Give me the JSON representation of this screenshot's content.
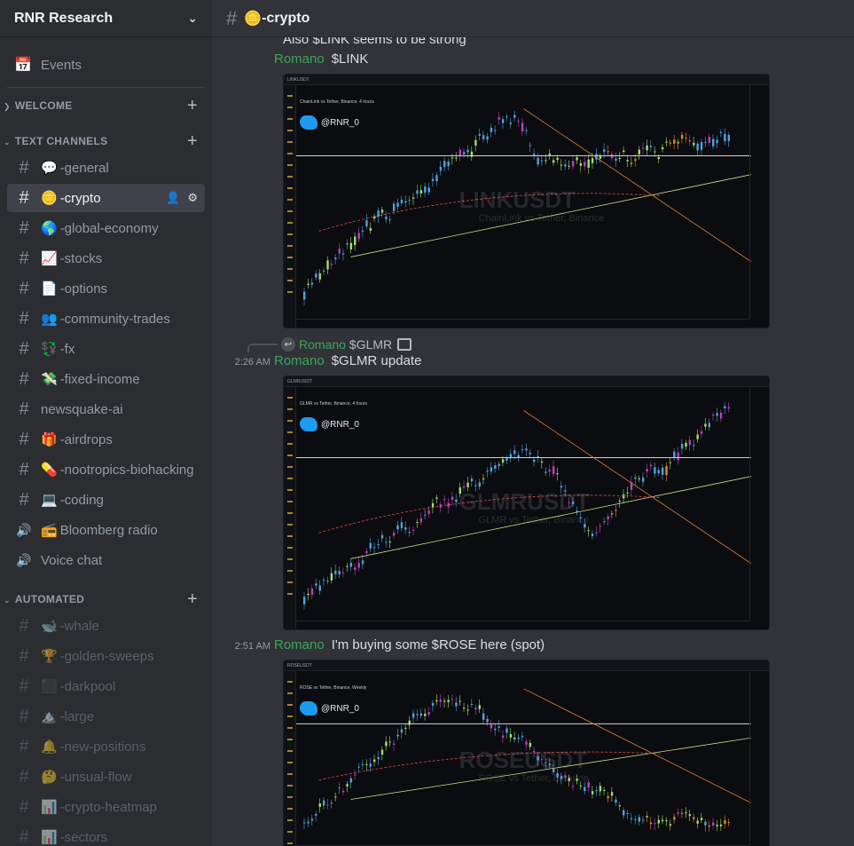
{
  "server": {
    "name": "RNR Research"
  },
  "sidebar": {
    "events_label": "Events",
    "categories": {
      "welcome": "WELCOME",
      "text_channels": "TEXT CHANNELS",
      "automated": "AUTOMATED"
    },
    "channels": [
      {
        "emoji": "💬",
        "name": "-general"
      },
      {
        "emoji": "🪙",
        "name": "-crypto"
      },
      {
        "emoji": "🌎",
        "name": "-global-economy"
      },
      {
        "emoji": "📈",
        "name": "-stocks"
      },
      {
        "emoji": "📄",
        "name": "-options"
      },
      {
        "emoji": "👥",
        "name": "-community-trades"
      },
      {
        "emoji": "💱",
        "name": "-fx"
      },
      {
        "emoji": "💸",
        "name": "-fixed-income"
      },
      {
        "emoji": "",
        "name": "newsquake-ai"
      },
      {
        "emoji": "🎁",
        "name": "-airdrops"
      },
      {
        "emoji": "💊",
        "name": "-nootropics-biohacking"
      },
      {
        "emoji": "💻",
        "name": "-coding"
      },
      {
        "emoji": "📻",
        "name": " Bloomberg radio"
      },
      {
        "emoji": "",
        "name": "Voice chat"
      }
    ],
    "automated": [
      {
        "emoji": "🐋",
        "name": "-whale"
      },
      {
        "emoji": "🏆",
        "name": "-golden-sweeps"
      },
      {
        "emoji": "⬛",
        "name": "-darkpool"
      },
      {
        "emoji": "🏔️",
        "name": "-large"
      },
      {
        "emoji": "🔔",
        "name": "-new-positions"
      },
      {
        "emoji": "🤔",
        "name": "-unsual-flow"
      },
      {
        "emoji": "📊",
        "name": "-crypto-heatmap"
      },
      {
        "emoji": "📊",
        "name": "-sectors"
      }
    ]
  },
  "header": {
    "channel": "-crypto",
    "emoji": "🪙"
  },
  "messages": {
    "cut_text": "Also $LINK seems to be strong",
    "m1": {
      "author": "Romano",
      "text": "$LINK"
    },
    "m2": {
      "reply_author": "Romano",
      "reply_text": "$GLMR",
      "time": "2:26 AM",
      "author": "Romano",
      "text": "$GLMR update"
    },
    "m3": {
      "time": "2:51 AM",
      "author": "Romano",
      "text": "I'm buying some $ROSE here (spot)"
    }
  },
  "charts": {
    "handle": "@RNR_0",
    "c1": {
      "symbol": "LINKUSDT",
      "desc": "ChainLink vs Tether, Binance",
      "meta": "ChainLink vs Tether, Binance, 4 hours"
    },
    "c2": {
      "symbol": "GLMRUSDT",
      "desc": "GLMR vs Tether, Binance",
      "meta": "GLMR vs Tether, Binance, 4 hours"
    },
    "c3": {
      "symbol": "ROSEUSDT",
      "desc": "ROSE vs Tether, Binance",
      "meta": "ROSE vs Tether, Binance, Weekly"
    }
  }
}
